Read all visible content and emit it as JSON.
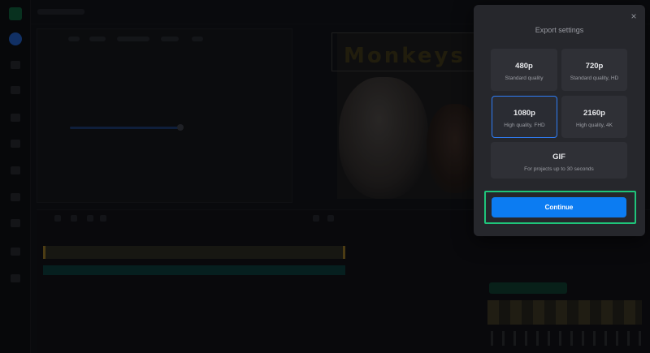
{
  "modal": {
    "title": "Export settings",
    "close_label": "×",
    "options": [
      {
        "label": "480p",
        "sub": "Standard quality"
      },
      {
        "label": "720p",
        "sub": "Standard quality, HD"
      },
      {
        "label": "1080p",
        "sub": "High quality, FHD"
      },
      {
        "label": "2160p",
        "sub": "High quality, 4K"
      },
      {
        "label": "GIF",
        "sub": "For projects up to 30 seconds"
      }
    ],
    "selected_option": "1080p",
    "continue_label": "Continue"
  },
  "preview": {
    "title_text": "Monkeys"
  },
  "colors": {
    "accent": "#0c7cf2",
    "highlight": "#1fc47a",
    "modal_bg": "#26272c"
  }
}
